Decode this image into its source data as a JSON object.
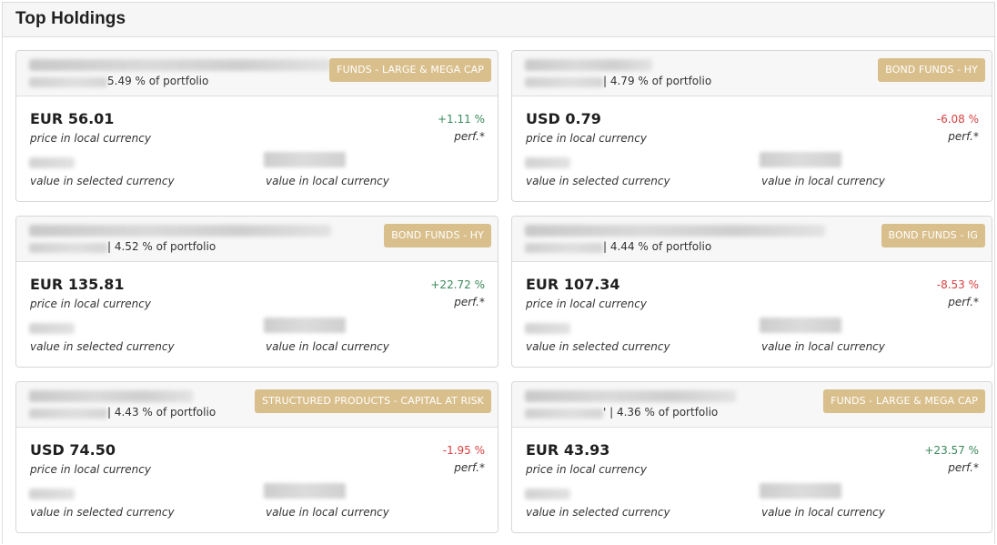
{
  "panel": {
    "title": "Top Holdings"
  },
  "labels": {
    "price_caption": "price in local currency",
    "perf_caption": "perf.*",
    "value_selected_caption": "value in selected currency",
    "value_local_caption": "value in local currency"
  },
  "colors": {
    "badge": "#d9bf8c",
    "positive": "#3a8a5a",
    "negative": "#d84040"
  },
  "holdings": [
    {
      "portfolio_text": "5.49 % of portfolio",
      "category": "FUNDS - LARGE & MEGA CAP",
      "price": "EUR 56.01",
      "perf": "+1.11 %",
      "trend": "pos"
    },
    {
      "portfolio_text": "| 4.79 % of portfolio",
      "category": "BOND FUNDS - HY",
      "price": "USD 0.79",
      "perf": "-6.08 %",
      "trend": "neg"
    },
    {
      "portfolio_text": "| 4.52 % of portfolio",
      "category": "BOND FUNDS - HY",
      "price": "EUR 135.81",
      "perf": "+22.72 %",
      "trend": "pos"
    },
    {
      "portfolio_text": "| 4.44 % of portfolio",
      "category": "BOND FUNDS - IG",
      "price": "EUR 107.34",
      "perf": "-8.53 %",
      "trend": "neg"
    },
    {
      "portfolio_text": "| 4.43 % of portfolio",
      "category": "STRUCTURED PRODUCTS - CAPITAL AT RISK",
      "price": "USD 74.50",
      "perf": "-1.95 %",
      "trend": "neg"
    },
    {
      "portfolio_text": "' | 4.36 % of portfolio",
      "category": "FUNDS - LARGE & MEGA CAP",
      "price": "EUR 43.93",
      "perf": "+23.57 %",
      "trend": "pos"
    }
  ]
}
